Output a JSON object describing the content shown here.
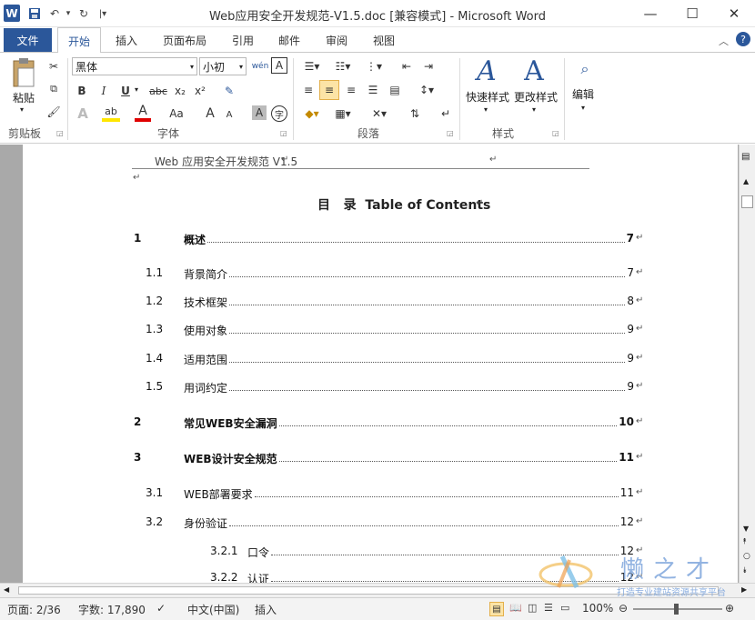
{
  "window": {
    "title": "Web应用安全开发规范-V1.5.doc [兼容模式] - Microsoft Word",
    "minimize": "—",
    "maximize": "☐",
    "close": "✕"
  },
  "tabs": {
    "file": "文件",
    "items": [
      "开始",
      "插入",
      "页面布局",
      "引用",
      "邮件",
      "审阅",
      "视图"
    ]
  },
  "ribbon": {
    "clipboard": {
      "paste": "粘贴",
      "label": "剪贴板"
    },
    "font": {
      "name": "黑体",
      "size": "小初",
      "label": "字体",
      "bold": "B",
      "italic": "I",
      "underline": "U",
      "strike": "abc",
      "sub": "x₂",
      "sup": "x²",
      "phonetic": "wén",
      "grow": "A",
      "shrink": "A",
      "case": "Aa"
    },
    "paragraph": {
      "label": "段落"
    },
    "styles": {
      "quick": "快速样式",
      "change": "更改样式",
      "label": "样式"
    },
    "editing": {
      "label": "编辑"
    }
  },
  "document": {
    "header": "Web 应用安全开发规范  V1.5",
    "toc_title": "目   录  Table of Contents",
    "entries": [
      {
        "num": "1",
        "text": "概述",
        "page": "7",
        "level": 1
      },
      {
        "num": "1.1",
        "text": "背景简介",
        "page": "7",
        "level": 2
      },
      {
        "num": "1.2",
        "text": "技术框架",
        "page": "8",
        "level": 2
      },
      {
        "num": "1.3",
        "text": "使用对象",
        "page": "9",
        "level": 2
      },
      {
        "num": "1.4",
        "text": "适用范围",
        "page": "9",
        "level": 2
      },
      {
        "num": "1.5",
        "text": "用词约定",
        "page": "9",
        "level": 2
      },
      {
        "num": "2",
        "text": "常见WEB安全漏洞",
        "page": "10",
        "level": 1
      },
      {
        "num": "3",
        "text": "WEB设计安全规范",
        "page": "11",
        "level": 1
      },
      {
        "num": "3.1",
        "text": "WEB部署要求",
        "page": "11",
        "level": 2
      },
      {
        "num": "3.2",
        "text": "身份验证",
        "page": "12",
        "level": 2
      },
      {
        "num": "3.2.1",
        "text": "口令",
        "page": "12",
        "level": 3
      },
      {
        "num": "3.2.2",
        "text": "认证",
        "page": "12",
        "level": 3
      }
    ]
  },
  "status": {
    "page": "页面: 2/36",
    "words": "字数: 17,890",
    "lang": "中文(中国)",
    "mode": "插入",
    "zoom": "100%"
  },
  "watermark": {
    "text": "懒之才",
    "sub": "打造专业建站资源共享平台"
  }
}
